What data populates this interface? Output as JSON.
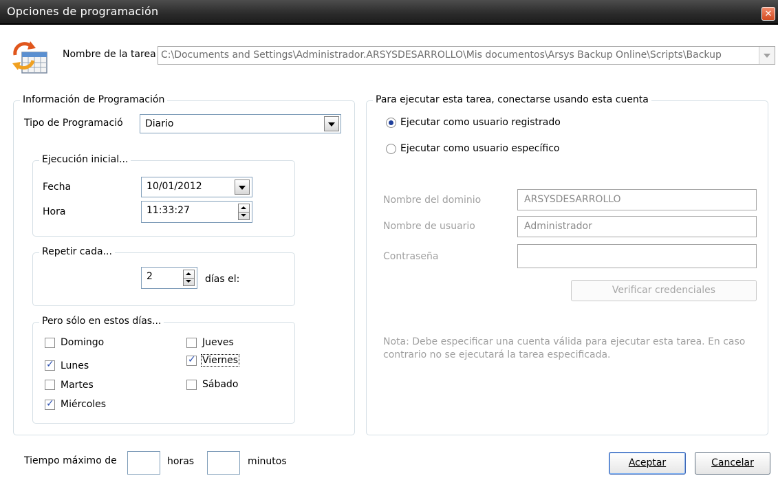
{
  "window": {
    "title": "Opciones de programación",
    "close_icon": "close-icon"
  },
  "task": {
    "label": "Nombre de la tarea",
    "path": "C:\\Documents and Settings\\Administrador.ARSYSDESARROLLO\\Mis documentos\\Arsys Backup Online\\Scripts\\Backup",
    "icon": "schedule-refresh-icon"
  },
  "schedule_group": {
    "legend": "Información de Programación",
    "type_label": "Tipo de Programació",
    "type_value": "Diario",
    "initial": {
      "legend": "Ejecución inicial...",
      "date_label": "Fecha",
      "date_value": "10/01/2012",
      "time_label": "Hora",
      "time_value": "11:33:27"
    },
    "repeat": {
      "legend": "Repetir cada...",
      "value": "2",
      "suffix": "días el:"
    },
    "days": {
      "legend": "Pero sólo en estos días...",
      "items": [
        {
          "label": "Domingo",
          "checked": false
        },
        {
          "label": "Lunes",
          "checked": true
        },
        {
          "label": "Martes",
          "checked": false
        },
        {
          "label": "Miércoles",
          "checked": true
        },
        {
          "label": "Jueves",
          "checked": false
        },
        {
          "label": "Viernes",
          "checked": true
        },
        {
          "label": "Sábado",
          "checked": false
        }
      ]
    }
  },
  "max_time": {
    "label": "Tiempo máximo de",
    "hours_value": "",
    "hours_label": "horas",
    "minutes_value": "",
    "minutes_label": "minutos"
  },
  "account_group": {
    "legend": "Para ejecutar esta tarea, conectarse usando esta cuenta",
    "radio_registered": "Ejecutar como usuario registrado",
    "radio_specific": "Ejecutar como usuario específico",
    "selected": "registered",
    "domain_label": "Nombre del dominio",
    "domain_value": "ARSYSDESARROLLO",
    "user_label": "Nombre de usuario",
    "user_value": "Administrador",
    "password_label": "Contraseña",
    "password_value": "",
    "verify_button": "Verificar credenciales",
    "note": "Nota: Debe especificar una cuenta válida para ejecutar esta tarea. En caso contrario no se ejecutará la tarea especificada."
  },
  "buttons": {
    "accept": "Aceptar",
    "cancel": "Cancelar"
  },
  "colors": {
    "titlebar": "#2a2a2a",
    "group_border": "#d5dfe5",
    "check_mark": "#2a4fb0",
    "close_button": "#d34a20"
  }
}
